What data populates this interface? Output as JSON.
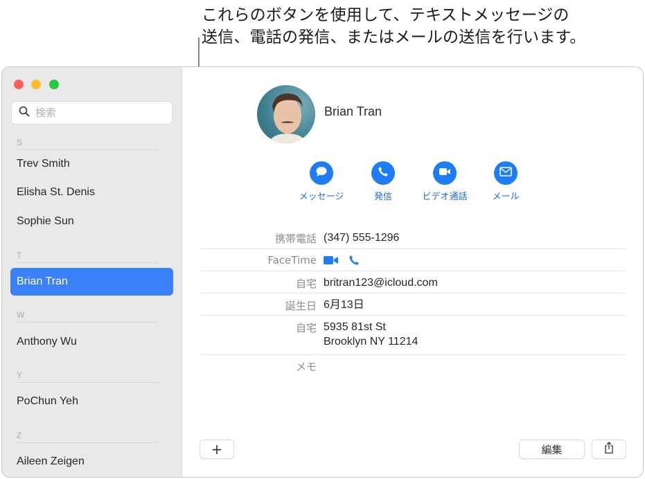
{
  "callout": {
    "line1": "これらのボタンを使用して、テキストメッセージの",
    "line2": "送信、電話の発信、またはメールの送信を行います。"
  },
  "window": {
    "traffic_lights": [
      "close",
      "minimize",
      "zoom"
    ]
  },
  "sidebar": {
    "search": {
      "placeholder": "検索",
      "value": "",
      "icon": "search-icon"
    },
    "sections": [
      {
        "letter": "S",
        "contacts": [
          "Trev Smith",
          "Elisha St. Denis",
          "Sophie Sun"
        ]
      },
      {
        "letter": "T",
        "contacts": [
          "Brian Tran"
        ]
      },
      {
        "letter": "W",
        "contacts": [
          "Anthony Wu"
        ]
      },
      {
        "letter": "Y",
        "contacts": [
          "PoChun Yeh"
        ]
      },
      {
        "letter": "Z",
        "contacts": [
          "Aileen Zeigen"
        ]
      }
    ],
    "selected_contact": "Brian Tran"
  },
  "detail": {
    "name": "Brian Tran",
    "actions": [
      {
        "label": "メッセージ",
        "icon": "message-bubble-icon"
      },
      {
        "label": "発信",
        "icon": "phone-icon"
      },
      {
        "label": "ビデオ通話",
        "icon": "video-camera-icon"
      },
      {
        "label": "メール",
        "icon": "envelope-icon"
      }
    ],
    "fields": {
      "mobile": {
        "label": "携帯電話",
        "value": "(347) 555-1296"
      },
      "facetime": {
        "label": "FaceTime",
        "icons": [
          "video-camera-icon",
          "phone-icon"
        ]
      },
      "email": {
        "label": "自宅",
        "value": "britran123@icloud.com"
      },
      "birthday": {
        "label": "誕生日",
        "value": "6月13日"
      },
      "address": {
        "label": "自宅",
        "line1": "5935 81st St",
        "line2": "Brooklyn NY 11214"
      },
      "note": {
        "label": "メモ",
        "value": ""
      }
    },
    "toolbar": {
      "add_label": "+",
      "edit_label": "編集",
      "share_icon": "share-icon"
    }
  },
  "colors": {
    "accent": "#1f7cf7",
    "selection": "#3a81f7",
    "sidebar_bg": "#e9e9e9"
  }
}
